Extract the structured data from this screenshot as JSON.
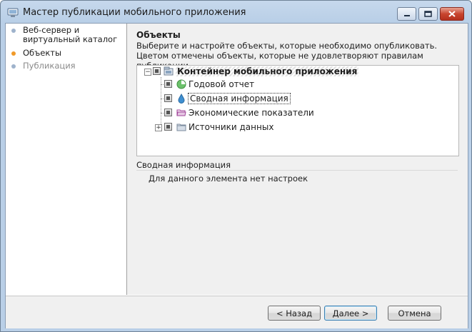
{
  "window": {
    "title": "Мастер публикации мобильного приложения"
  },
  "sidebar": {
    "steps": [
      {
        "label": "Веб-сервер и виртуальный каталог",
        "state": "done",
        "color": "#9fb3cc"
      },
      {
        "label": "Объекты",
        "state": "current",
        "color": "#f09a2a"
      },
      {
        "label": "Публикация",
        "state": "pending",
        "color": "#9fb3cc"
      }
    ]
  },
  "main": {
    "title": "Объекты",
    "description": "Выберите и настройте объекты, которые необходимо опубликовать. Цветом отмечены объекты, которые не удовлетворяют правилам публикации.",
    "tree": {
      "root": {
        "label": "Контейнер мобильного приложения",
        "expanded": true
      },
      "children": [
        {
          "label": "Годовой отчет",
          "icon": "report-icon"
        },
        {
          "label": "Сводная информация",
          "icon": "dashboard-icon",
          "selected": true
        },
        {
          "label": "Экономические показатели",
          "icon": "folder-open-icon"
        },
        {
          "label": "Источники данных",
          "icon": "folder-icon",
          "expandable": true
        }
      ]
    },
    "info": {
      "title": "Сводная информация",
      "text": "Для данного элемента нет настроек"
    }
  },
  "footer": {
    "back_label": "< Назад",
    "next_label": "Далее >",
    "cancel_label": "Отмена"
  }
}
